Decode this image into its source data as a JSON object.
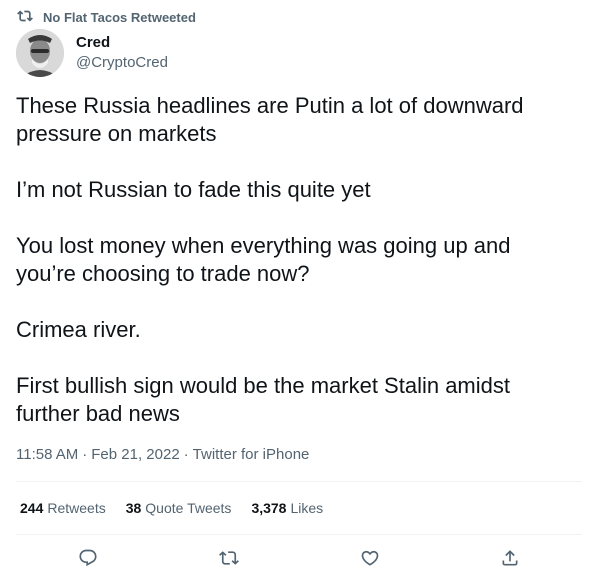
{
  "retweet_banner": {
    "icon": "retweet-icon",
    "text": "No Flat Tacos Retweeted"
  },
  "author": {
    "display_name": "Cred",
    "handle": "@CryptoCred"
  },
  "tweet": {
    "paragraphs": [
      "These Russia headlines are Putin a lot of downward pressure on markets",
      "I’m not Russian to fade this quite yet",
      "You lost money when everything was going up and you’re choosing to trade now?",
      "Crimea river.",
      "First bullish sign would be the market Stalin amidst further bad news"
    ],
    "time": "11:58 AM",
    "date": "Feb 21, 2022",
    "source": "Twitter for iPhone",
    "separator": "·"
  },
  "stats": {
    "retweets": {
      "count": "244",
      "label": "Retweets"
    },
    "quote_tweets": {
      "count": "38",
      "label": "Quote Tweets"
    },
    "likes": {
      "count": "3,378",
      "label": "Likes"
    }
  },
  "actions": [
    {
      "name": "reply",
      "icon": "reply-icon"
    },
    {
      "name": "retweet",
      "icon": "retweet-icon"
    },
    {
      "name": "like",
      "icon": "heart-icon"
    },
    {
      "name": "share",
      "icon": "share-icon"
    }
  ],
  "colors": {
    "text_primary": "#0f1419",
    "text_secondary": "#536471",
    "divider": "#eff3f4"
  }
}
